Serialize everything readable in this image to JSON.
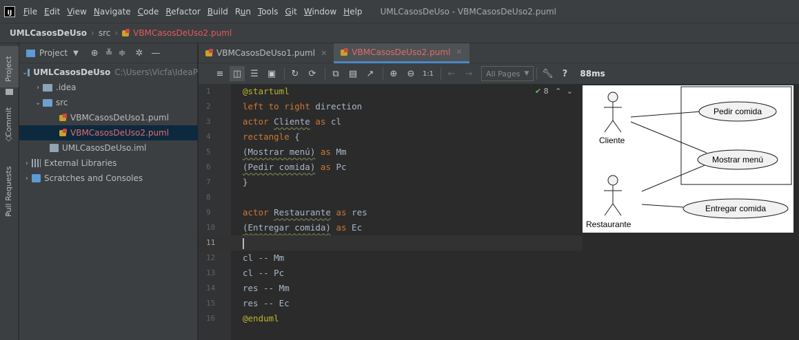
{
  "menubar": {
    "logo": "IJ",
    "items": [
      {
        "label": "File",
        "mnemonic": "F",
        "rest": "ile"
      },
      {
        "label": "Edit",
        "mnemonic": "E",
        "rest": "dit"
      },
      {
        "label": "View",
        "mnemonic": "V",
        "rest": "iew"
      },
      {
        "label": "Navigate",
        "mnemonic": "N",
        "rest": "avigate"
      },
      {
        "label": "Code",
        "mnemonic": "C",
        "rest": "ode"
      },
      {
        "label": "Refactor",
        "mnemonic": "R",
        "rest": "efactor"
      },
      {
        "label": "Build",
        "mnemonic": "B",
        "rest": "uild"
      },
      {
        "label": "Run",
        "pre": "R",
        "mnemonic": "u",
        "rest": "n"
      },
      {
        "label": "Tools",
        "mnemonic": "T",
        "rest": "ools"
      },
      {
        "label": "Git",
        "mnemonic": "G",
        "rest": "it"
      },
      {
        "label": "Window",
        "mnemonic": "W",
        "rest": "indow"
      },
      {
        "label": "Help",
        "mnemonic": "H",
        "rest": "elp"
      }
    ],
    "window_title": "UMLCasosDeUso - VBMCasosDeUso2.puml"
  },
  "breadcrumbs": {
    "project": "UMLCasosDeUso",
    "folder": "src",
    "file": "VBMCasosDeUso2.puml"
  },
  "left_strip": {
    "project": "Project",
    "commit": "Commit",
    "pull_requests": "Pull Requests"
  },
  "project_panel": {
    "title": "Project",
    "root_name": "UMLCasosDeUso",
    "root_path": "C:\\Users\\Vicfa\\IdeaP",
    "idea": ".idea",
    "src": "src",
    "file1": "VBMCasosDeUso1.puml",
    "file2": "VBMCasosDeUso2.puml",
    "iml": "UMLCasosDeUso.iml",
    "external_libraries": "External Libraries",
    "scratches": "Scratches and Consoles"
  },
  "tabs": {
    "tab1": "VBMCasosDeUso1.puml",
    "tab2": "VBMCasosDeUso2.puml"
  },
  "toolbar": {
    "zoom_label": "1:1",
    "all_pages": "All Pages",
    "timing": "88ms",
    "help": "?"
  },
  "editor": {
    "inspections_count": "8",
    "current_line": 11,
    "line_numbers": [
      "1",
      "2",
      "3",
      "4",
      "5",
      "6",
      "7",
      "8",
      "9",
      "10",
      "11",
      "12",
      "13",
      "14",
      "15",
      "16"
    ],
    "line1": "@startuml",
    "line2a": "left to ",
    "line2b": "right",
    "line2c": " direction",
    "line3a": "actor ",
    "line3b": "Cliente",
    "line3c": " as ",
    "line3d": "cl",
    "line4a": "rectangle",
    "line4b": " {",
    "line5a": "(Mostrar menú)",
    "line5b": " as ",
    "line5c": "Mm",
    "line6a": "(Pedir comida)",
    "line6b": " as ",
    "line6c": "Pc",
    "line7": "}",
    "line9a": "actor ",
    "line9b": "Restaurante",
    "line9c": " as ",
    "line9d": "res",
    "line10a": "(Entregar comida)",
    "line10b": " as ",
    "line10c": "Ec",
    "line12": "cl -- Mm",
    "line13": "cl -- Pc",
    "line14": "res -- Mm",
    "line15": "res -- Ec",
    "line16": "@enduml"
  },
  "diagram": {
    "actor1": "Cliente",
    "actor2": "Restaurante",
    "uc_pedir": "Pedir comida",
    "uc_mostrar": "Mostrar menú",
    "uc_entregar": "Entregar comida"
  }
}
